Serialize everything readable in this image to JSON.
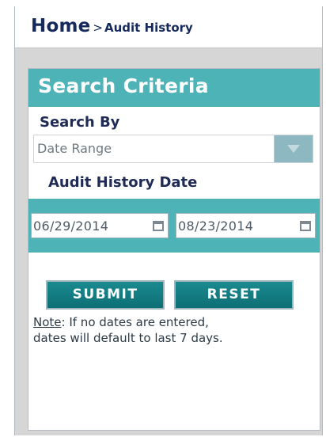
{
  "breadcrumb": {
    "home": "Home",
    "separator": ">",
    "current": "Audit History"
  },
  "search": {
    "title": "Search Criteria",
    "search_by_label": "Search By",
    "search_by_value": "Date Range",
    "date_label": "Audit History Date",
    "date_from": "06/29/2014",
    "date_to": "08/23/2014",
    "submit_label": "SUBMIT",
    "reset_label": "RESET",
    "note_label": "Note",
    "note_line1": ": If no dates are entered,",
    "note_line2": "dates will default to last 7 days."
  },
  "icons": {
    "dropdown": "chevron-down-icon",
    "calendar": "calendar-icon"
  },
  "colors": {
    "accent_teal": "#4eb3b7",
    "button_teal": "#0d6f75",
    "navy_text": "#15295c"
  }
}
